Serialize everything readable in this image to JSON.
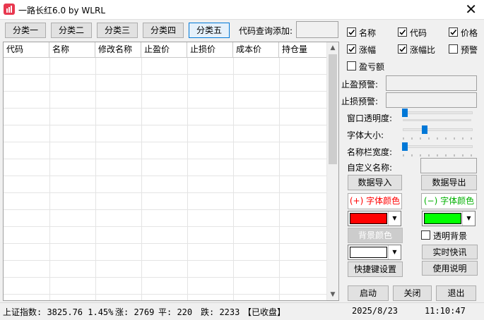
{
  "window": {
    "title": "一路长红6.0 by WLRL",
    "close_glyph": "✕"
  },
  "toolbar": {
    "tabs": [
      "分类一",
      "分类二",
      "分类三",
      "分类四",
      "分类五"
    ],
    "active_tab": 4,
    "code_query_label": "代码查询添加:",
    "code_query_value": ""
  },
  "grid": {
    "columns": [
      "代码",
      "名称",
      "修改名称",
      "止盈价",
      "止损价",
      "成本价",
      "持仓量"
    ],
    "rows": []
  },
  "options": {
    "checkboxes": [
      {
        "label": "名称",
        "checked": true
      },
      {
        "label": "代码",
        "checked": true
      },
      {
        "label": "价格",
        "checked": true
      },
      {
        "label": "涨幅",
        "checked": true
      },
      {
        "label": "涨幅比",
        "checked": true
      },
      {
        "label": "预警",
        "checked": false
      },
      {
        "label": "盈亏额",
        "checked": false
      }
    ],
    "take_profit_alert_label": "止盈预警:",
    "take_profit_alert_value": "",
    "stop_loss_alert_label": "止损预警:",
    "stop_loss_alert_value": "",
    "opacity_label": "窗口透明度:",
    "opacity_level": 0.0,
    "font_size_label": "字体大小:",
    "font_size_level": 0.3,
    "name_width_label": "名称栏宽度:",
    "name_width_level": 0.0,
    "custom_name_label": "自定义名称:",
    "custom_name_value": "",
    "import_label": "数据导入",
    "export_label": "数据导出",
    "up_color_label": "(+) 字体颜色",
    "down_color_label": "(−) 字体颜色",
    "up_color": "#ff0000",
    "down_color": "#00ff00",
    "bg_color_label": "背景颜色",
    "bg_color": "#ffffff",
    "transparent_bg_label": "透明背景",
    "transparent_bg_checked": false,
    "news_label": "实时快讯",
    "hotkey_label": "快捷键设置",
    "manual_label": "使用说明",
    "start_label": "启动",
    "close_label": "关闭",
    "exit_label": "退出"
  },
  "status": {
    "index_text": "上证指数: 3825.76  1.45%",
    "up_text": "涨: 2769",
    "flat_text": "平: 220",
    "down_text": "跌: 2233",
    "market_text": "【已收盘】",
    "date": "2025/8/23",
    "time": "11:10:47"
  },
  "colors": {
    "up_label": "#ff0000",
    "down_label": "#00b000",
    "accent": "#0078d7"
  },
  "icons": {
    "app": "red-candlestick-icon",
    "close": "close-icon",
    "dropdown": "chevron-down-icon",
    "check": "check-icon"
  }
}
